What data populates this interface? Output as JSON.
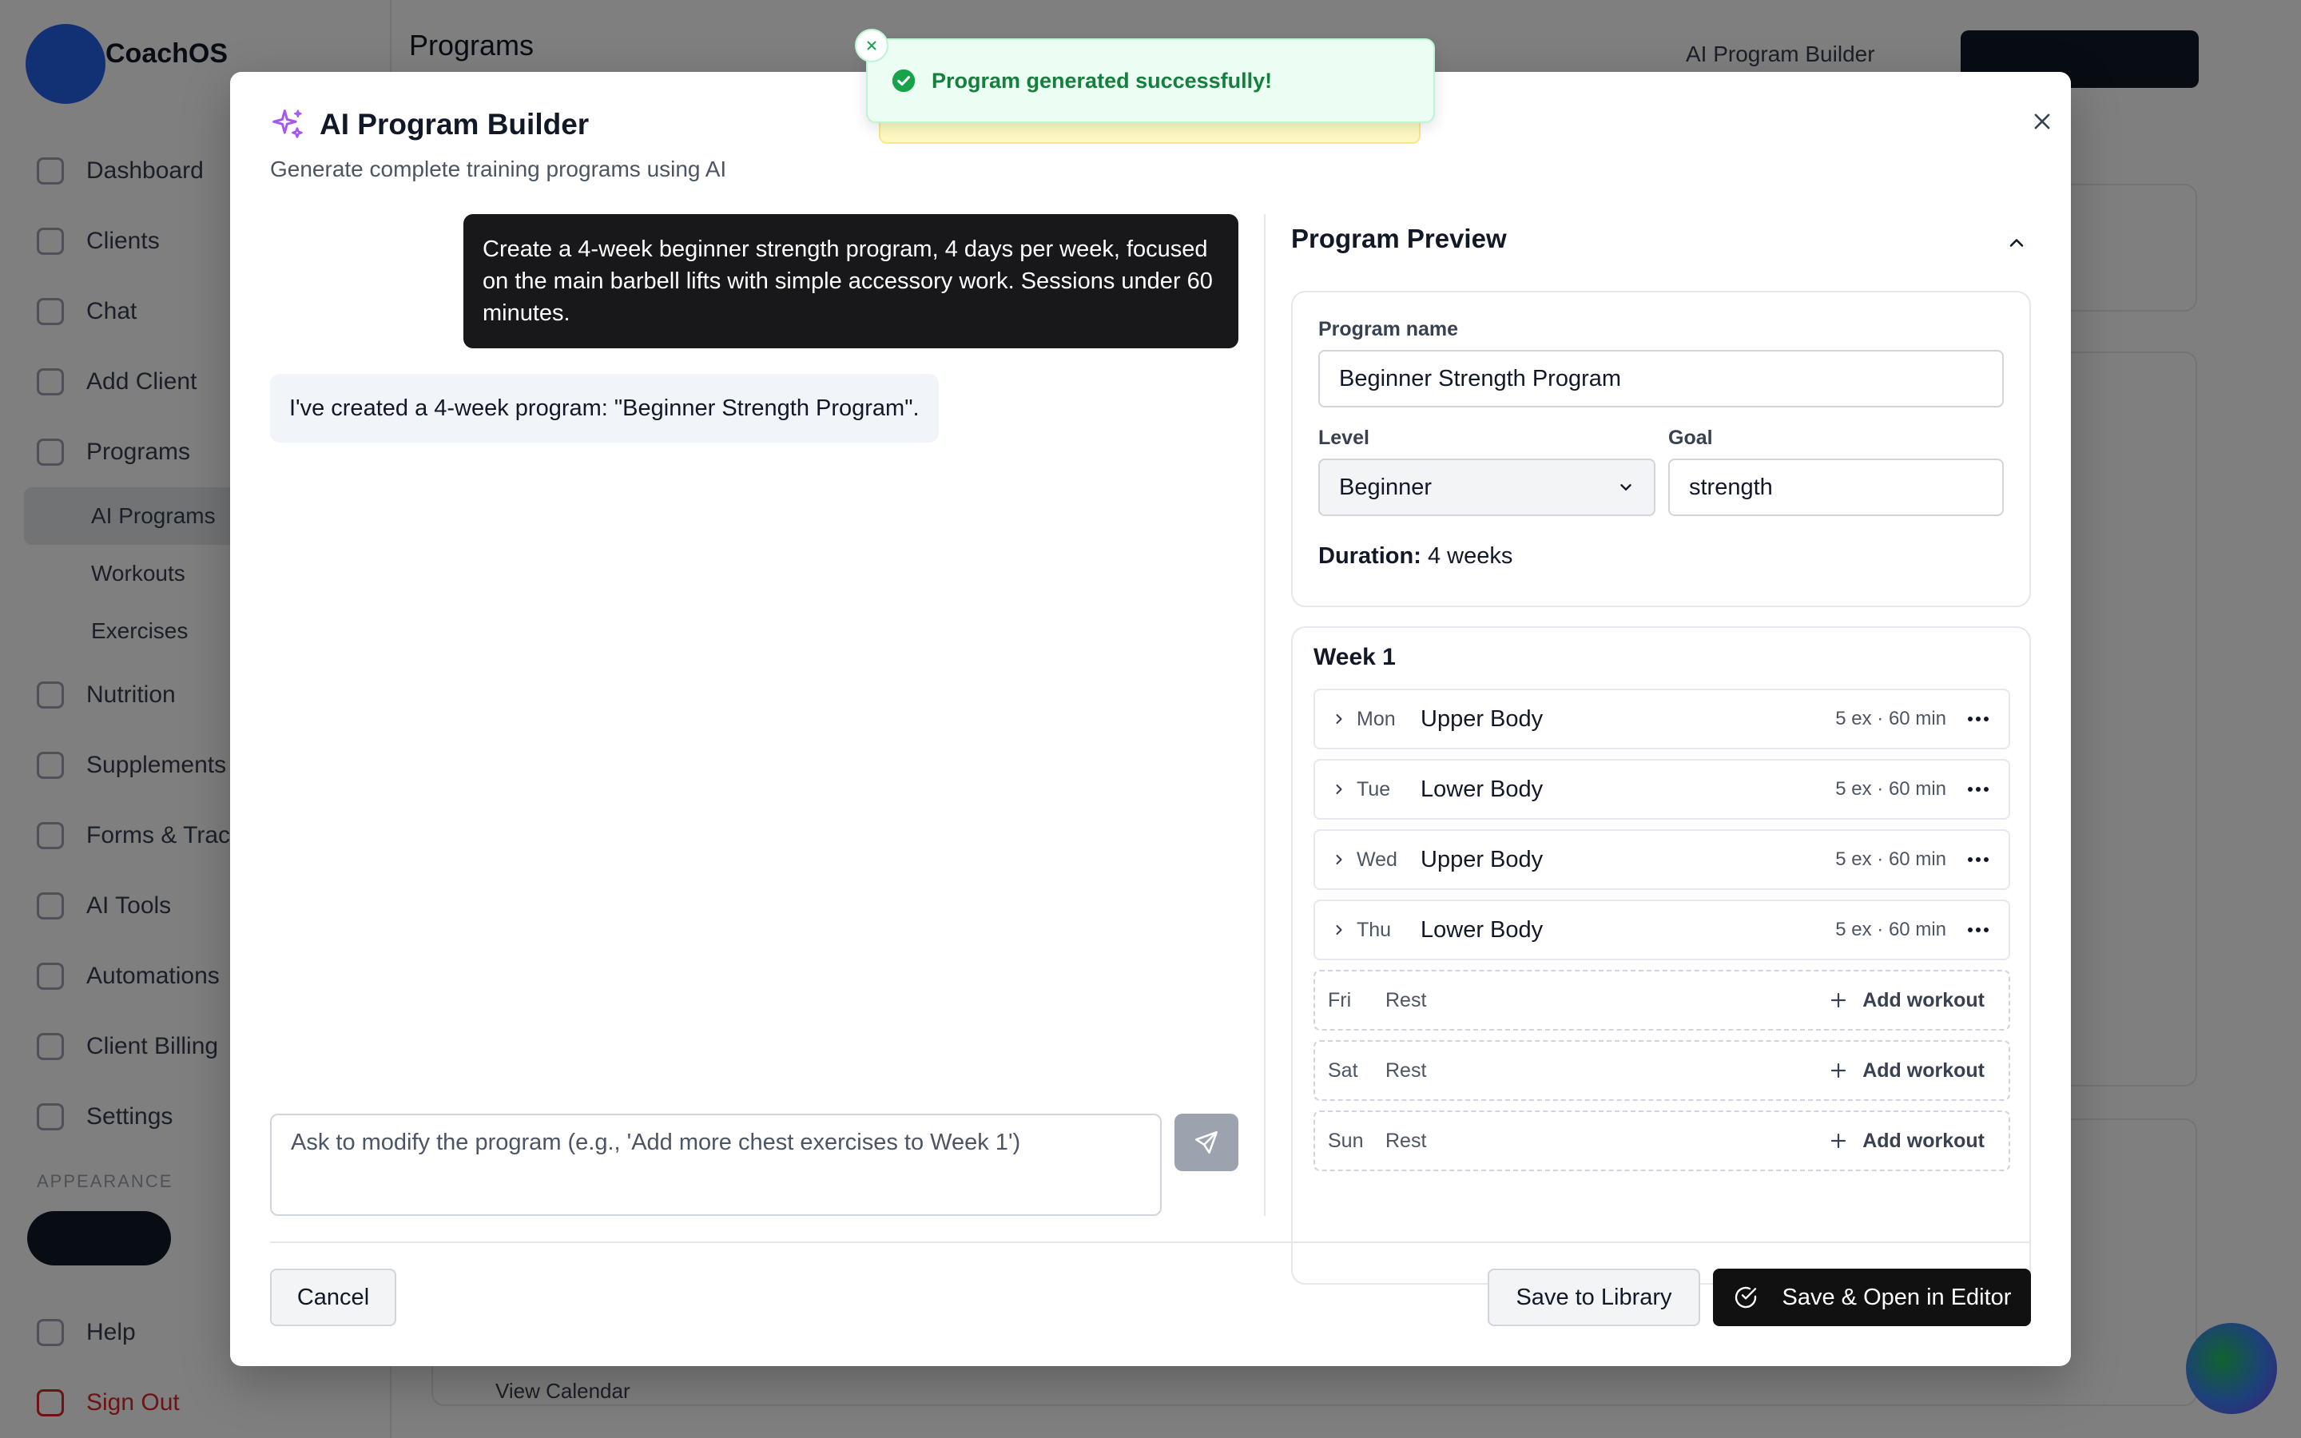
{
  "background": {
    "brand": "CoachOS",
    "page_title": "Programs",
    "header_button_ai": "AI Program Builder",
    "nav": [
      "Dashboard",
      "Clients",
      "Chat",
      "Add Client",
      "Programs"
    ],
    "nav_sub": [
      "AI Programs",
      "Workouts",
      "Exercises"
    ],
    "nav2": [
      "Nutrition",
      "Supplements",
      "Forms & Tracking",
      "AI Tools",
      "Automations",
      "Client Billing",
      "Settings"
    ],
    "section_label": "APPEARANCE",
    "footer_nav": [
      "Help",
      "Sign Out"
    ],
    "bg_link": "View Calendar"
  },
  "toast": {
    "message": "Program generated successfully!",
    "status_color": "#16a34a"
  },
  "modal": {
    "title": "AI Program Builder",
    "subtitle": "Generate complete training programs using AI",
    "accent_color": "#a855f7"
  },
  "chat": {
    "user_message": "Create a 4-week beginner strength program, 4 days per week, focused on the main barbell lifts with simple accessory work. Sessions under 60 minutes.",
    "ai_message": "I've created a 4-week program: \"Beginner Strength Program\".",
    "input_placeholder": "Ask to modify the program (e.g., 'Add more chest exercises to Week 1')",
    "input_value": ""
  },
  "preview": {
    "title": "Program Preview",
    "program_name_label": "Program name",
    "program_name_value": "Beginner Strength Program",
    "level_label": "Level",
    "level_value": "Beginner",
    "goal_label": "Goal",
    "goal_value": "strength",
    "duration_label": "Duration:",
    "duration_value": "4 weeks",
    "week_title": "Week 1",
    "workouts": [
      {
        "day": "Mon",
        "name": "Upper Body",
        "meta": "5 ex · 60 min"
      },
      {
        "day": "Tue",
        "name": "Lower Body",
        "meta": "5 ex · 60 min"
      },
      {
        "day": "Wed",
        "name": "Upper Body",
        "meta": "5 ex · 60 min"
      },
      {
        "day": "Thu",
        "name": "Lower Body",
        "meta": "5 ex · 60 min"
      }
    ],
    "rest_days": [
      {
        "day": "Fri",
        "label": "Rest",
        "action": "Add workout"
      },
      {
        "day": "Sat",
        "label": "Rest",
        "action": "Add workout"
      },
      {
        "day": "Sun",
        "label": "Rest",
        "action": "Add workout"
      }
    ]
  },
  "footer": {
    "cancel_label": "Cancel",
    "save_library_label": "Save to Library",
    "save_open_label": "Save & Open in Editor"
  }
}
